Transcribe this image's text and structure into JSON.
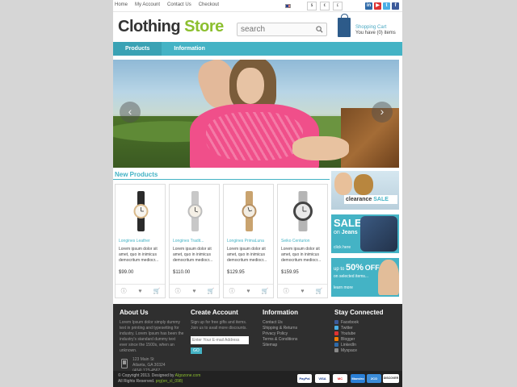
{
  "topbar": {
    "links": [
      "Home",
      "My Account",
      "Contact Us",
      "Checkout"
    ],
    "currencies": [
      "$",
      "€",
      "£"
    ],
    "social": [
      {
        "icon": "linkedin-icon",
        "letter": "in",
        "color": "#2f6aa8"
      },
      {
        "icon": "youtube-icon",
        "letter": "▶",
        "color": "#d33"
      },
      {
        "icon": "twitter-icon",
        "letter": "t",
        "color": "#4aaee6"
      },
      {
        "icon": "facebook-icon",
        "letter": "f",
        "color": "#3b5a9a"
      }
    ]
  },
  "header": {
    "logo_main": "Clothing ",
    "logo_accent": "Store",
    "search_placeholder": "search",
    "cart_title": "Shopping Cart",
    "cart_count": "You have (0) items"
  },
  "nav": {
    "items": [
      "Products",
      "Information"
    ]
  },
  "hero": {
    "prev": "‹",
    "next": "›"
  },
  "new_products": {
    "title": "New Products",
    "items": [
      {
        "name": "Longines Leather",
        "desc": "Lorem ipsum dolor sit amet, quo in inimicus democritum mediocr...",
        "price": "$99.00"
      },
      {
        "name": "Longines Tradit...",
        "desc": "Lorem ipsum dolor sit amet, quo in inimicus democritum mediocr...",
        "price": "$110.00"
      },
      {
        "name": "Longines PrimaLuna",
        "desc": "Lorem ipsum dolor sit amet, quo in inimicus democritum mediocr...",
        "price": "$129.95"
      },
      {
        "name": "Seiko Centurion",
        "desc": "Lorem ipsum dolor sit amet, quo in inimicus democritum mediocr...",
        "price": "$159.95"
      }
    ]
  },
  "banners": {
    "clearance_a": "clearance",
    "clearance_b": "SALE",
    "sale_title": "SALE",
    "sale_on": "on",
    "sale_sub": "Jeans",
    "click_here": "click here",
    "upto_a": "up to",
    "upto_pct": "50%",
    "upto_off": "OFF",
    "upto_sub": "on selected items...",
    "learn_more": "learn more"
  },
  "footer": {
    "about": {
      "title": "About Us",
      "text": "Lorem Ipsum dolor simply dummy text in printing and typesetting for industry. Lorem Ipsum has been the industry's standard dummy text ever since the 1500s, when an unknown.",
      "address1": "123 Main St",
      "address2": "Atlanta, GA 30324",
      "phone": "(404) 123-4567"
    },
    "account": {
      "title": "Create Account",
      "text": "Sign up for free gifts and items. Join us to avail more discounts.",
      "placeholder": "Enter Your E-mail Address",
      "button": "GO"
    },
    "info": {
      "title": "Information",
      "links": [
        "Contact Us",
        "Shipping & Returns",
        "Privacy Policy",
        "Terms & Conditions",
        "Sitemap"
      ]
    },
    "stay": {
      "title": "Stay Connected",
      "links": [
        {
          "label": "Facebook",
          "color": "#3b5a9a"
        },
        {
          "label": "Twitter",
          "color": "#4aaee6"
        },
        {
          "label": "Youtube",
          "color": "#d33"
        },
        {
          "label": "Blogger",
          "color": "#f57d00"
        },
        {
          "label": "LinkedIn",
          "color": "#2f6aa8"
        },
        {
          "label": "Myspace",
          "color": "#888"
        }
      ]
    },
    "copy1a": "© Copyright 2013. Designed by ",
    "copy1b": "Algozone.com",
    "copy2a": "All Rights Reserved. ",
    "copy2b": "prg(en_cl_098)",
    "payments": [
      {
        "label": "PayPal",
        "color": "#fff",
        "text": "#1a3d8f"
      },
      {
        "label": "VISA",
        "color": "#fff",
        "text": "#1a3d8f"
      },
      {
        "label": "MC",
        "color": "#fff",
        "text": "#e22"
      },
      {
        "label": "Maestro",
        "color": "#2a7fd6",
        "text": "#fff"
      },
      {
        "label": "2CO",
        "color": "#3b8cd8",
        "text": "#fff"
      },
      {
        "label": "DISCOVER",
        "color": "#fff",
        "text": "#333"
      }
    ]
  }
}
